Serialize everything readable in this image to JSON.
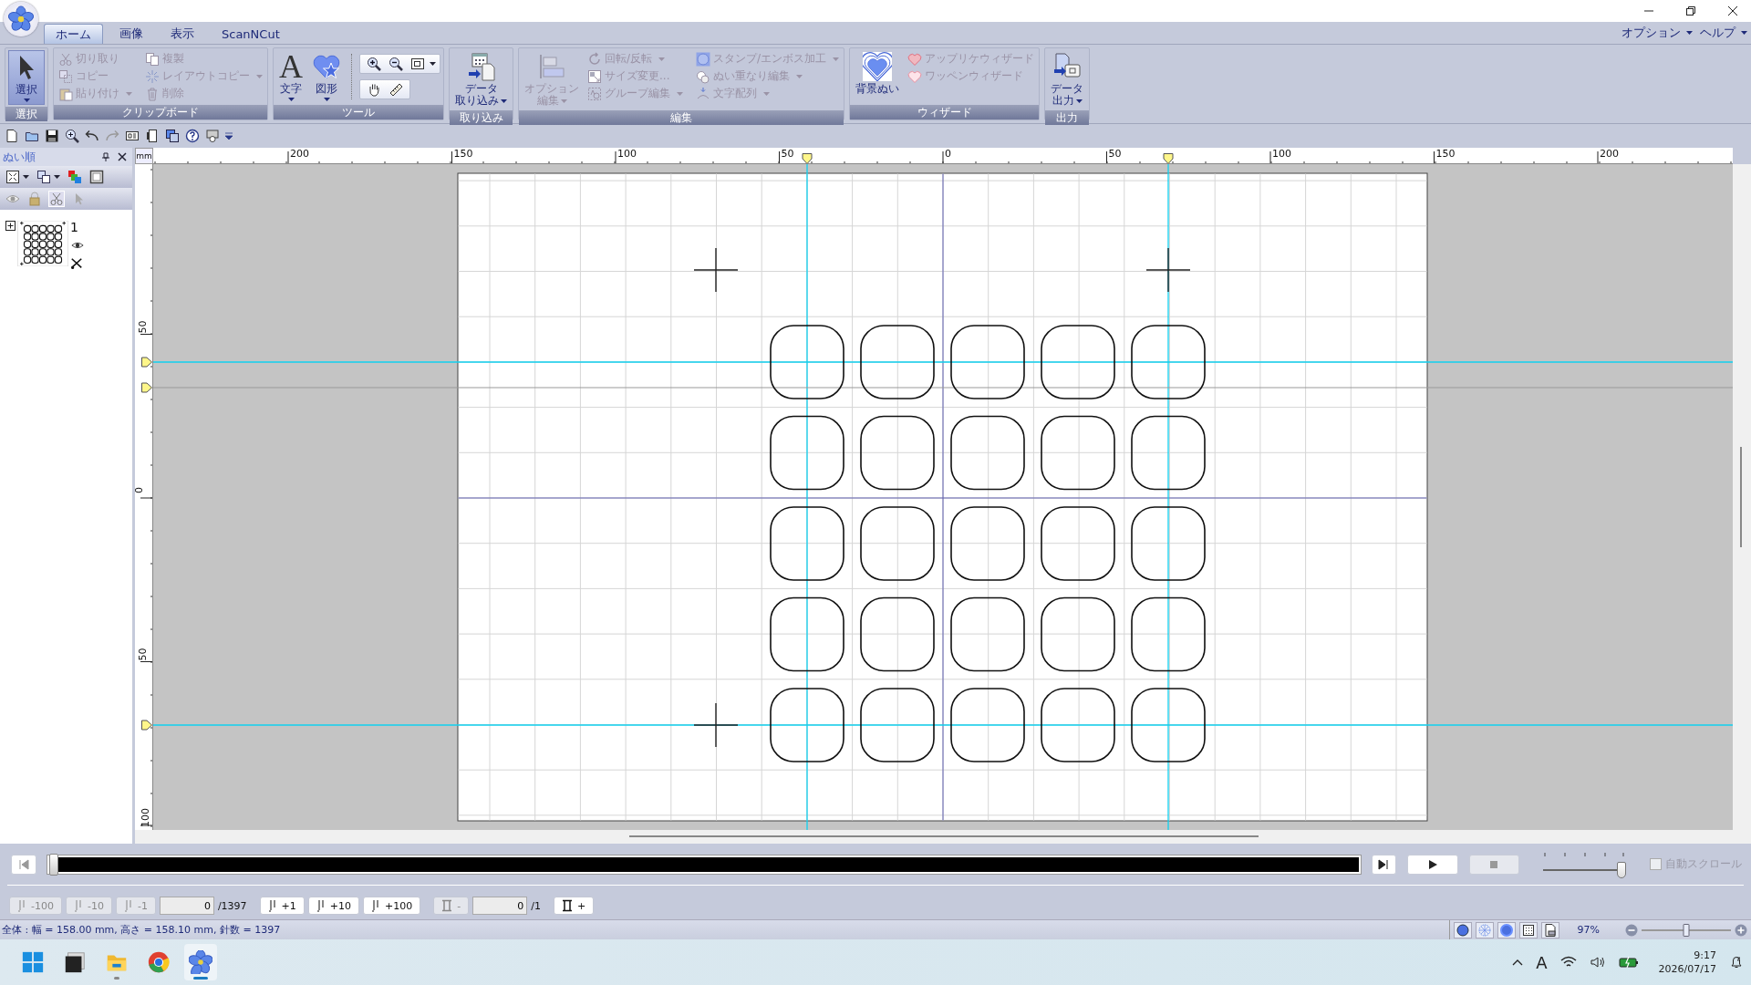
{
  "tabs": [
    {
      "label": "ホーム",
      "selected": true
    },
    {
      "label": "画像",
      "selected": false
    },
    {
      "label": "表示",
      "selected": false
    },
    {
      "label": "ScanNCut",
      "selected": false
    }
  ],
  "top_menus": [
    {
      "label": "オプション"
    },
    {
      "label": "ヘルプ"
    }
  ],
  "ribbon": [
    {
      "label": "選択",
      "items": [
        {
          "kind": "large",
          "lines": [
            "選択"
          ],
          "dropdown": true,
          "caret_below": true,
          "disabled": false,
          "pressed": true
        }
      ]
    },
    {
      "label": "クリップボード",
      "items": [
        {
          "kind": "small",
          "label": "切り取り",
          "disabled": true
        },
        {
          "kind": "small",
          "label": "コピー",
          "disabled": true
        },
        {
          "kind": "small",
          "label": "貼り付け",
          "dropdown": true,
          "disabled": true
        },
        {
          "kind": "small",
          "label": "複製",
          "disabled": true
        },
        {
          "kind": "small",
          "label": "レイアウトコピー",
          "dropdown": true,
          "disabled": true
        },
        {
          "kind": "small",
          "label": "削除",
          "disabled": true
        }
      ]
    },
    {
      "label": "ツール",
      "items": [
        {
          "kind": "large",
          "glyph": "A",
          "lines": [
            "文字"
          ],
          "dropdown": true,
          "caret_below": true,
          "disabled": false
        },
        {
          "kind": "large",
          "lines": [
            "図形"
          ],
          "dropdown": true,
          "caret_below": true,
          "disabled": false
        },
        {
          "kind": "zoom_tools"
        }
      ]
    },
    {
      "label": "取り込み",
      "items": [
        {
          "kind": "large",
          "lines": [
            "データ",
            "取り込み"
          ],
          "dropdown": true,
          "disabled": false
        }
      ]
    },
    {
      "label": "編集",
      "items": [
        {
          "kind": "large",
          "lines": [
            "オプション",
            "編集"
          ],
          "dropdown": true,
          "disabled": true
        },
        {
          "kind": "small",
          "label": "回転/反転",
          "dropdown": true,
          "disabled": true
        },
        {
          "kind": "small",
          "label": "サイズ変更...",
          "disabled": true
        },
        {
          "kind": "small",
          "label": "グループ編集",
          "dropdown": true,
          "disabled": true
        },
        {
          "kind": "small",
          "label": "スタンプ/エンボス加工",
          "dropdown": true,
          "disabled": true
        },
        {
          "kind": "small",
          "label": "ぬい重なり編集",
          "dropdown": true,
          "disabled": true
        },
        {
          "kind": "small",
          "label": "文字配列",
          "dropdown": true,
          "disabled": true
        }
      ]
    },
    {
      "label": "ウィザード",
      "items": [
        {
          "kind": "large",
          "lines": [
            "背景ぬい"
          ],
          "disabled": false
        },
        {
          "kind": "small",
          "label": "アップリケウィザード",
          "disabled": true
        },
        {
          "kind": "small",
          "label": "ワッペンウィザード",
          "disabled": true
        }
      ]
    },
    {
      "label": "出力",
      "items": [
        {
          "kind": "large",
          "lines": [
            "データ",
            "出力"
          ],
          "dropdown": true,
          "disabled": false
        }
      ]
    }
  ],
  "sew_order": {
    "title": "ぬい順",
    "items": [
      {
        "label": "1",
        "expanded": false
      }
    ]
  },
  "rulers": {
    "unit": "mm",
    "horizontal": [
      "200",
      "150",
      "100",
      "50",
      "0",
      "50",
      "100",
      "150",
      "200"
    ],
    "vertical": [
      "50",
      "0",
      "50",
      "100"
    ]
  },
  "player": {
    "progress": {
      "level": 0
    },
    "speed": {
      "level": 1
    },
    "stop_disabled": true,
    "auto_scroll": {
      "label": "自動スクロール",
      "checked": false,
      "disabled": true
    }
  },
  "stitch_nav": [
    {
      "items": [
        {
          "kind": "needle",
          "label": "-100",
          "disabled": true
        },
        {
          "kind": "needle",
          "label": "-10",
          "disabled": true
        },
        {
          "kind": "needle",
          "label": "-1",
          "disabled": true
        },
        {
          "kind": "field",
          "value": "0"
        },
        {
          "kind": "total",
          "label": "/1397"
        }
      ]
    },
    {
      "items": [
        {
          "kind": "needle",
          "label": "+1",
          "disabled": false
        },
        {
          "kind": "needle",
          "label": "+10",
          "disabled": false
        },
        {
          "kind": "needle",
          "label": "+100",
          "disabled": false
        }
      ]
    },
    {
      "items": [
        {
          "kind": "thread",
          "label": "-",
          "disabled": true
        },
        {
          "kind": "field",
          "value": "0"
        },
        {
          "kind": "total",
          "label": "/1"
        }
      ]
    },
    {
      "items": [
        {
          "kind": "thread",
          "label": "+",
          "disabled": false
        }
      ]
    }
  ],
  "status_bar": {
    "text": "全体 : 幅 = 158.00 mm, 高さ = 158.10 mm, 針数 = 1397",
    "zoom": "97%",
    "zoom_slider": {
      "level": 0.5
    }
  },
  "taskbar": {
    "apps": [
      {
        "running": false,
        "active": false
      },
      {
        "running": false,
        "active": false
      },
      {
        "running": true,
        "active": false
      },
      {
        "running": false,
        "active": false
      },
      {
        "running": true,
        "active": true
      }
    ],
    "ime": "A",
    "time": "9:17",
    "date": "2026/07/17"
  }
}
